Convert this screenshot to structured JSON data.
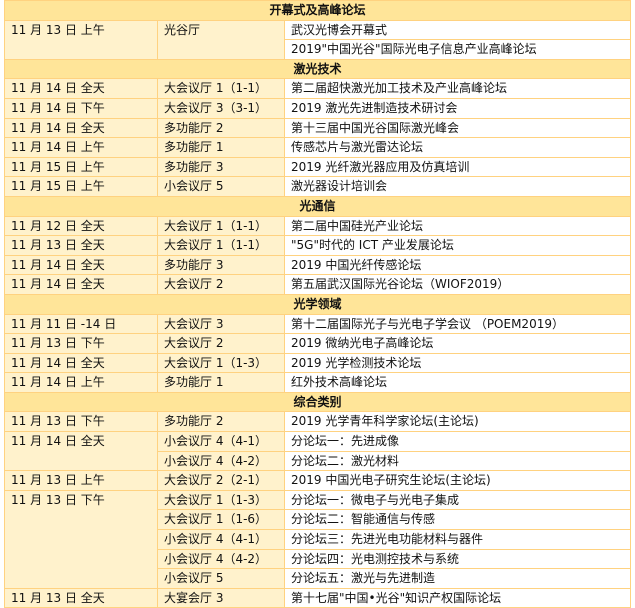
{
  "colors": {
    "section_bg": "#ffe599",
    "row_bg": "#fff2cc",
    "border": "#ffd280"
  },
  "sections": [
    {
      "title": "开幕式及高峰论坛",
      "rows": [
        {
          "date": "11 月 13 日 上午",
          "venue": "光谷厅",
          "topic": "武汉光博会开幕式",
          "merge_down": true
        },
        {
          "date": "",
          "venue": "",
          "topic": "2019\"中国光谷\"国际光电子信息产业高峰论坛",
          "merged": true
        }
      ]
    },
    {
      "title": "激光技术",
      "rows": [
        {
          "date": "11 月 14 日 全天",
          "venue": "大会议厅 1（1-1）",
          "topic": "第二届超快激光加工技术及产业高峰论坛"
        },
        {
          "date": "11 月 14 日 下午",
          "venue": "大会议厅 3（3-1）",
          "topic": "2019 激光先进制造技术研讨会"
        },
        {
          "date": "11 月 14 日 全天",
          "venue": "多功能厅 2",
          "topic": "第十三届中国光谷国际激光峰会"
        },
        {
          "date": "11 月 14 日 上午",
          "venue": "多功能厅 1",
          "topic": "传感芯片与激光雷达论坛"
        },
        {
          "date": "11 月 15 日 上午",
          "venue": "多功能厅 3",
          "topic": "2019 光纤激光器应用及仿真培训"
        },
        {
          "date": "11 月 15 日 上午",
          "venue": "小会议厅 5",
          "topic": "激光器设计培训会"
        }
      ]
    },
    {
      "title": "光通信",
      "rows": [
        {
          "date": "11 月 12 日 全天",
          "venue": "大会议厅 1（1-1）",
          "topic": "第二届中国硅光产业论坛"
        },
        {
          "date": "11 月 13 日 全天",
          "venue": "大会议厅 1（1-1）",
          "topic": "\"5G\"时代的 ICT 产业发展论坛"
        },
        {
          "date": "11 月 14 日 全天",
          "venue": "多功能厅 3",
          "topic": "2019 中国光纤传感论坛"
        },
        {
          "date": "11 月 14 日 全天",
          "venue": "大会议厅 2",
          "topic": "第五届武汉国际光谷论坛（WIOF2019）"
        }
      ]
    },
    {
      "title": "光学领域",
      "rows": [
        {
          "date": "11 月 11 日 -14 日",
          "venue": "大会议厅 3",
          "topic": "第十二届国际光子与光电子学会议 （POEM2019）"
        },
        {
          "date": "11 月 13 日 下午",
          "venue": "大会议厅 2",
          "topic": "2019 微纳光电子高峰论坛"
        },
        {
          "date": "11 月 14 日 全天",
          "venue": "大会议厅 1（1-3）",
          "topic": "2019 光学检测技术论坛"
        },
        {
          "date": "11 月 14 日 上午",
          "venue": "多功能厅 1",
          "topic": "红外技术高峰论坛"
        }
      ]
    },
    {
      "title": "综合类别",
      "rows": [
        {
          "date": "11 月 13 日 下午",
          "venue": "多功能厅 2",
          "topic": "2019 光学青年科学家论坛(主论坛)"
        },
        {
          "date": "11 月 14 日 全天",
          "venue": "小会议厅 4（4-1）",
          "topic": "分论坛一：先进成像",
          "merge_down": true
        },
        {
          "date": "",
          "venue": "小会议厅 4（4-2）",
          "topic": "分论坛二：激光材料",
          "merged": true
        },
        {
          "date": "11 月 13 日 上午",
          "venue": "大会议厅 2（2-1）",
          "topic": "2019 中国光电子研究生论坛(主论坛)"
        },
        {
          "date": "11 月 13 日 下午",
          "venue": "大会议厅 1（1-3）",
          "topic": "分论坛一：微电子与光电子集成",
          "merge_down": true
        },
        {
          "date": "",
          "venue": "大会议厅 1（1-6）",
          "topic": "分论坛二：智能通信与传感",
          "merged": true
        },
        {
          "date": "",
          "venue": "小会议厅 4（4-1）",
          "topic": "分论坛三：先进光电功能材料与器件",
          "merged": true
        },
        {
          "date": "",
          "venue": "小会议厅 4（4-2）",
          "topic": "分论坛四：光电测控技术与系统",
          "merged": true
        },
        {
          "date": "",
          "venue": "小会议厅 5",
          "topic": "分论坛五：激光与先进制造",
          "merged": true
        },
        {
          "date": "11 月 13 日 全天",
          "venue": "大宴会厅 3",
          "topic": "第十七届\"中国•光谷\"知识产权国际论坛"
        }
      ]
    }
  ]
}
